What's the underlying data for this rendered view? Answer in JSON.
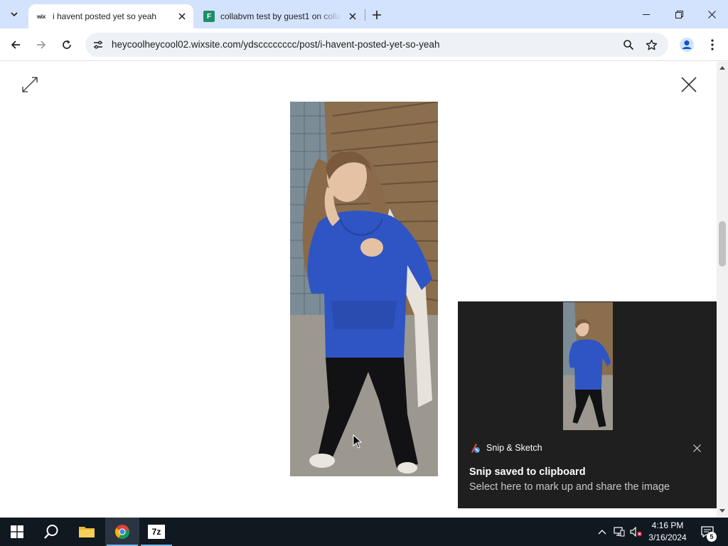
{
  "browser": {
    "tabs": [
      {
        "title": "i havent posted yet so yeah",
        "favicon_text": "wix",
        "active": true
      },
      {
        "title": "collabvm test by guest1 on collabvm",
        "favicon_text": "F",
        "active": false
      }
    ],
    "url": "heycoolheycool02.wixsite.com/ydscccccccc/post/i-havent-posted-yet-so-yeah"
  },
  "notification": {
    "app_name": "Snip & Sketch",
    "title": "Snip saved to clipboard",
    "body": "Select here to mark up and share the image"
  },
  "taskbar": {
    "apps": [
      "start",
      "search",
      "file-explorer",
      "chrome",
      "7-zip"
    ],
    "sevenzip_label": "7z",
    "time": "4:16 PM",
    "date": "3/16/2024",
    "notification_count": "5"
  },
  "colors": {
    "tabstrip": "#d3e3fd",
    "taskbar": "#101820",
    "toast": "#1f1f1f",
    "hoodie": "#2f55c4"
  }
}
